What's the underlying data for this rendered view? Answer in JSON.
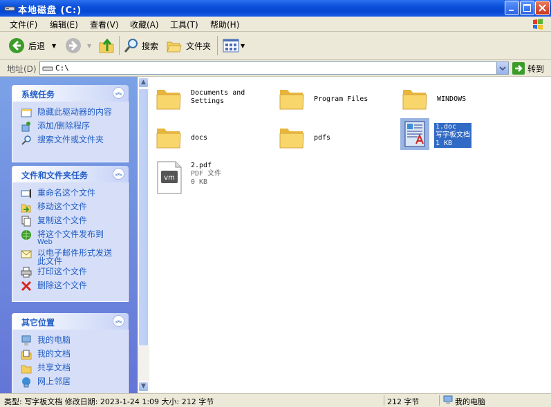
{
  "window": {
    "title": "本地磁盘  (C:)"
  },
  "menu": [
    "文件(F)",
    "编辑(E)",
    "查看(V)",
    "收藏(A)",
    "工具(T)",
    "帮助(H)"
  ],
  "toolbar": {
    "back": "后退",
    "search": "搜索",
    "folders": "文件夹"
  },
  "address": {
    "label": "地址(D)",
    "value": "C:\\",
    "go": "转到"
  },
  "system_tasks": {
    "title": "系统任务",
    "items": [
      "隐藏此驱动器的内容",
      "添加/删除程序",
      "搜索文件或文件夹"
    ]
  },
  "file_tasks": {
    "title": "文件和文件夹任务",
    "items": [
      {
        "label": "重命名这个文件"
      },
      {
        "label": "移动这个文件"
      },
      {
        "label": "复制这个文件"
      },
      {
        "label": "将这个文件发布到",
        "sub": "Web"
      },
      {
        "label": "以电子邮件形式发送",
        "sub": "此文件"
      },
      {
        "label": "打印这个文件"
      },
      {
        "label": "删除这个文件"
      }
    ]
  },
  "other_places": {
    "title": "其它位置",
    "items": [
      "我的电脑",
      "我的文档",
      "共享文档",
      "网上邻居"
    ]
  },
  "files": [
    {
      "name": "Documents and",
      "name2": "Settings",
      "kind": "folder"
    },
    {
      "name": "Program Files",
      "kind": "folder"
    },
    {
      "name": "WINDOWS",
      "kind": "folder"
    },
    {
      "name": "docs",
      "kind": "folder"
    },
    {
      "name": "pdfs",
      "kind": "folder"
    },
    {
      "name": "1.doc",
      "type": "写字板文档",
      "size": "1 KB",
      "kind": "doc",
      "selected": true
    },
    {
      "name": "2.pdf",
      "type": "PDF 文件",
      "size": "0 KB",
      "kind": "pdf"
    }
  ],
  "status": {
    "info": "类型: 写字板文档 修改日期: 2023-1-24 1:09 大小: 212 字节",
    "size": "212 字节",
    "location": "我的电脑"
  },
  "colors": {
    "title_bar": "#0a4fd8",
    "task_link": "#215dc6",
    "selection": "#316ac5"
  }
}
